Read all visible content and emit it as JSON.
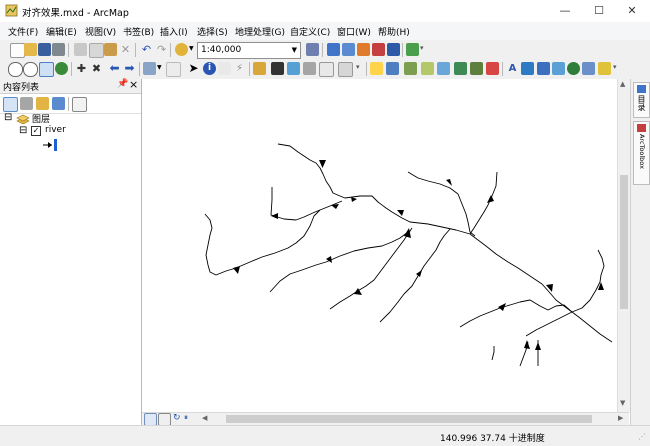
{
  "window": {
    "title": "对齐效果.mxd - ArcMap",
    "controls": {
      "minimize": "—",
      "maximize": "☐",
      "close": "✕"
    }
  },
  "menu": [
    "文件(F)",
    "编辑(E)",
    "视图(V)",
    "书签(B)",
    "插入(I)",
    "选择(S)",
    "地理处理(G)",
    "自定义(C)",
    "窗口(W)",
    "帮助(H)"
  ],
  "toolbar": {
    "scale_value": "1:40,000"
  },
  "toc": {
    "title": "内容列表",
    "pin": "📌",
    "close": "×",
    "group_label": "图层",
    "layer_label": "river",
    "group_expander": "⊟",
    "layer_expander": "⊟",
    "layer_checked": true
  },
  "right_dock": {
    "tab1": "目录",
    "tab2": "ArcToolbox"
  },
  "status": {
    "coordinates": "140.996  37.74 十进制度"
  },
  "colors": {
    "line": "#000000",
    "selection_blue": "#1f5fd4"
  }
}
